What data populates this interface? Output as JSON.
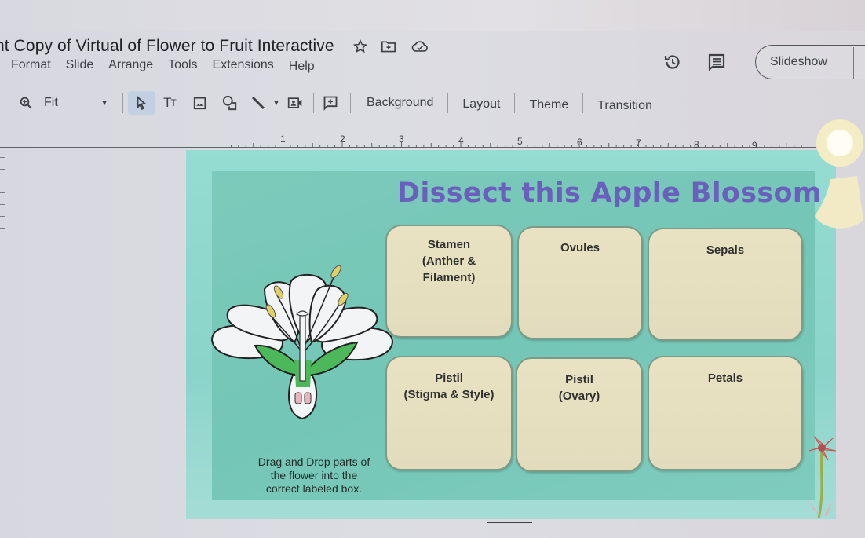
{
  "app": {
    "document_title": "nt Copy of Virtual of Flower to Fruit Interactive",
    "title_icons": [
      "star-icon",
      "move-to-folder-icon",
      "cloud-saved-icon"
    ]
  },
  "menu": {
    "items": [
      {
        "label": "Format"
      },
      {
        "label": "Slide"
      },
      {
        "label": "Arrange"
      },
      {
        "label": "Tools"
      },
      {
        "label": "Extensions"
      },
      {
        "label": "Help"
      }
    ]
  },
  "header_right": {
    "history_icon": "version-history-icon",
    "comments_icon": "comments-icon",
    "slideshow_label": "Slideshow"
  },
  "toolbar": {
    "zoom_icon": "zoom-icon",
    "zoom_value": "Fit",
    "tools": [
      "select-icon",
      "text-box-icon",
      "image-icon",
      "shape-icon",
      "line-icon",
      "video-icon",
      "comment-add-icon"
    ],
    "background_label": "Background",
    "layout_label": "Layout",
    "theme_label": "Theme",
    "transition_label": "Transition"
  },
  "ruler": {
    "numbers": [
      "1",
      "2",
      "3",
      "4",
      "5",
      "6",
      "7",
      "8",
      "9"
    ]
  },
  "slide": {
    "title": "Dissect this Apple Blossom",
    "colors": {
      "title": "#6a5fbc",
      "background": "#8fd6cc",
      "box_fill": "#e6dfc0"
    },
    "boxes": [
      {
        "line1": "Stamen",
        "line2": "(Anther &",
        "line3": "Filament)"
      },
      {
        "line1": "Ovules",
        "line2": "",
        "line3": ""
      },
      {
        "line1": "Sepals",
        "line2": "",
        "line3": ""
      },
      {
        "line1": "Pistil",
        "line2": "(Stigma & Style)",
        "line3": ""
      },
      {
        "line1": "Pistil",
        "line2": "(Ovary)",
        "line3": ""
      },
      {
        "line1": "Petals",
        "line2": "",
        "line3": ""
      }
    ],
    "instructions": {
      "line1": "Drag and Drop parts of",
      "line2": "the flower into the",
      "line3": "correct labeled box."
    }
  }
}
